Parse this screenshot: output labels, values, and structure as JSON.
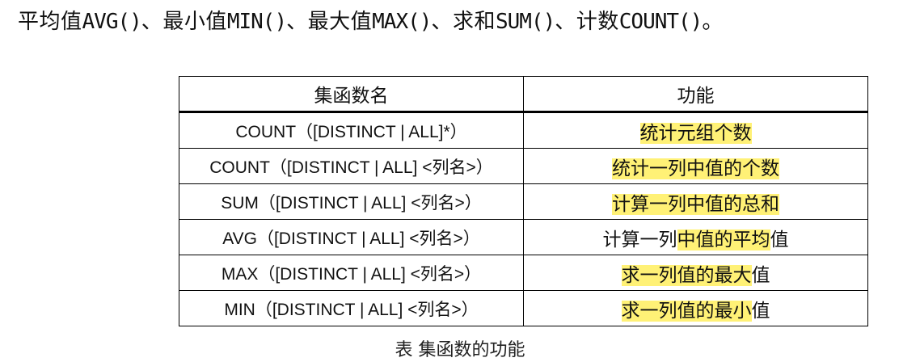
{
  "heading": {
    "avg_label": "平均值",
    "avg_fn": "AVG()",
    "sep1": "、",
    "min_label": "最小值",
    "min_fn": "MIN()",
    "sep2": "、",
    "max_label": "最大值",
    "max_fn": "MAX()",
    "sep3": "、",
    "sum_label": "求和",
    "sum_fn": "SUM()",
    "sep4": "、",
    "count_label": "计数",
    "count_fn": "COUNT()",
    "end": "。"
  },
  "table": {
    "headers": [
      "集函数名",
      "功能"
    ],
    "rows": [
      {
        "fn": "COUNT（[DISTINCT | ALL]*）",
        "desc_plain_before": "",
        "desc_highlight": "统计元组个数",
        "desc_plain_after": ""
      },
      {
        "fn": "COUNT（[DISTINCT | ALL] <列名>）",
        "desc_plain_before": "",
        "desc_highlight": "统计一列中值的个数",
        "desc_plain_after": ""
      },
      {
        "fn": "SUM（[DISTINCT | ALL] <列名>）",
        "desc_plain_before": "",
        "desc_highlight": "计算一列中值的总和",
        "desc_plain_after": ""
      },
      {
        "fn": "AVG（[DISTINCT | ALL] <列名>）",
        "desc_plain_before": "计算一列",
        "desc_highlight": "中值的平均",
        "desc_plain_after": "值"
      },
      {
        "fn": "MAX（[DISTINCT | ALL] <列名>）",
        "desc_plain_before": "",
        "desc_highlight": "求一列值的最大",
        "desc_plain_after": "值"
      },
      {
        "fn": "MIN（[DISTINCT | ALL] <列名>）",
        "desc_plain_before": "",
        "desc_highlight": "求一列值的最小",
        "desc_plain_after": "值"
      }
    ]
  },
  "caption": "表  集函数的功能",
  "colors": {
    "highlight": "#fff176",
    "text": "#111111",
    "border": "#000000"
  }
}
